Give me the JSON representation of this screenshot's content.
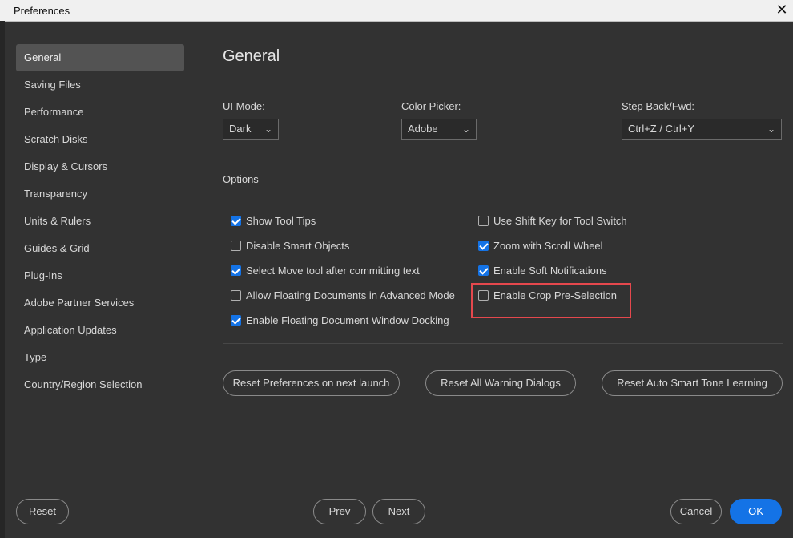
{
  "window": {
    "title": "Preferences",
    "close_icon": "close-icon"
  },
  "sidebar": {
    "items": [
      {
        "label": "General",
        "active": true
      },
      {
        "label": "Saving Files"
      },
      {
        "label": "Performance"
      },
      {
        "label": "Scratch Disks"
      },
      {
        "label": "Display & Cursors"
      },
      {
        "label": "Transparency"
      },
      {
        "label": "Units & Rulers"
      },
      {
        "label": "Guides & Grid"
      },
      {
        "label": "Plug-Ins"
      },
      {
        "label": "Adobe Partner Services"
      },
      {
        "label": "Application Updates"
      },
      {
        "label": "Type"
      },
      {
        "label": "Country/Region Selection"
      }
    ]
  },
  "main": {
    "title": "General",
    "ui_mode": {
      "label": "UI Mode:",
      "value": "Dark"
    },
    "color_picker": {
      "label": "Color Picker:",
      "value": "Adobe"
    },
    "step_back": {
      "label": "Step Back/Fwd:",
      "value": "Ctrl+Z / Ctrl+Y"
    },
    "options_label": "Options",
    "options_left": [
      {
        "label": "Show Tool Tips",
        "checked": true
      },
      {
        "label": "Disable Smart Objects",
        "checked": false
      },
      {
        "label": "Select Move tool after committing text",
        "checked": true
      },
      {
        "label": "Allow Floating Documents in Advanced Mode",
        "checked": false
      },
      {
        "label": "Enable Floating Document Window Docking",
        "checked": true
      }
    ],
    "options_right": [
      {
        "label": "Use Shift Key for Tool Switch",
        "checked": false
      },
      {
        "label": "Zoom with Scroll Wheel",
        "checked": true
      },
      {
        "label": "Enable Soft Notifications",
        "checked": true
      },
      {
        "label": "Enable Crop Pre-Selection",
        "checked": false
      }
    ],
    "buttons": {
      "reset_prefs": "Reset Preferences on next launch",
      "reset_warnings": "Reset All Warning Dialogs",
      "reset_tone": "Reset Auto Smart Tone Learning"
    }
  },
  "footer": {
    "reset": "Reset",
    "prev": "Prev",
    "next": "Next",
    "cancel": "Cancel",
    "ok": "OK"
  },
  "colors": {
    "accent": "#1473e6",
    "highlight": "#e5484d",
    "background": "#323232"
  }
}
